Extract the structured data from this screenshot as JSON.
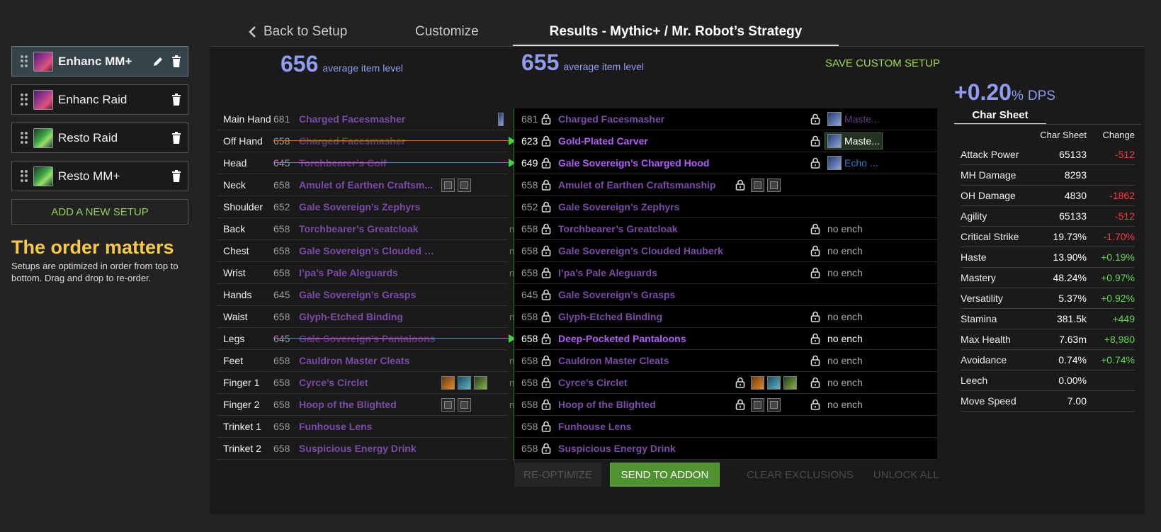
{
  "colors": {
    "accent": "#8f9cf0",
    "positive": "#5fd94a",
    "negative": "#ff3b3b",
    "epic": "#7b4ba8",
    "gold": "#f7c948",
    "green_action": "#4f9330"
  },
  "sidebar": {
    "setups": [
      {
        "name": "Enhanc MM+",
        "icon": "enhancement-icon",
        "active": true
      },
      {
        "name": "Enhanc Raid",
        "icon": "enhancement-icon",
        "active": false
      },
      {
        "name": "Resto Raid",
        "icon": "restoration-icon",
        "active": false
      },
      {
        "name": "Resto MM+",
        "icon": "restoration-icon",
        "active": false
      }
    ],
    "add_setup": "ADD A NEW SETUP",
    "order_title": "The order matters",
    "order_desc": "Setups are optimized in order from top to bottom. Drag and drop to re-order."
  },
  "tabs": {
    "back": "Back to Setup",
    "customize": "Customize",
    "results": "Results - Mythic+ / Mr. Robot’s Strategy"
  },
  "left": {
    "ilvl": "656",
    "ilvl_label": "average item level"
  },
  "right": {
    "ilvl": "655",
    "ilvl_label": "average item level",
    "save_custom": "SAVE CUSTOM SETUP"
  },
  "left_items": [
    {
      "slot": "Main Hand",
      "ilvl": "681",
      "name": "Charged Facesmasher",
      "changed": false,
      "trunc": ""
    },
    {
      "slot": "Off Hand",
      "ilvl": "658",
      "name": "Charged Facesmasher",
      "changed": true,
      "trunc": ""
    },
    {
      "slot": "Head",
      "ilvl": "645",
      "name": "Torchbearer’s Coif",
      "changed": true,
      "trunc": ""
    },
    {
      "slot": "Neck",
      "ilvl": "658",
      "name": "Amulet of Earthen Craftsm...",
      "changed": false,
      "trunc": ""
    },
    {
      "slot": "Shoulder",
      "ilvl": "652",
      "name": "Gale Sovereign’s Zephyrs",
      "changed": false,
      "trunc": ""
    },
    {
      "slot": "Back",
      "ilvl": "658",
      "name": "Torchbearer’s Greatcloak",
      "changed": false,
      "trunc": "n"
    },
    {
      "slot": "Chest",
      "ilvl": "658",
      "name": "Gale Sovereign’s Clouded H...",
      "changed": false,
      "trunc": "n"
    },
    {
      "slot": "Wrist",
      "ilvl": "658",
      "name": "I’pa’s Pale Aleguards",
      "changed": false,
      "trunc": "n"
    },
    {
      "slot": "Hands",
      "ilvl": "645",
      "name": "Gale Sovereign’s Grasps",
      "changed": false,
      "trunc": ""
    },
    {
      "slot": "Waist",
      "ilvl": "658",
      "name": "Glyph-Etched Binding",
      "changed": false,
      "trunc": "n"
    },
    {
      "slot": "Legs",
      "ilvl": "645",
      "name": "Gale Sovereign’s Pantaloons",
      "changed": true,
      "trunc": ""
    },
    {
      "slot": "Feet",
      "ilvl": "658",
      "name": "Cauldron Master Cleats",
      "changed": false,
      "trunc": "n"
    },
    {
      "slot": "Finger 1",
      "ilvl": "658",
      "name": "Cyrce’s Circlet",
      "changed": false,
      "trunc": "n"
    },
    {
      "slot": "Finger 2",
      "ilvl": "658",
      "name": "Hoop of the Blighted",
      "changed": false,
      "trunc": "n"
    },
    {
      "slot": "Trinket 1",
      "ilvl": "658",
      "name": "Funhouse Lens",
      "changed": false,
      "trunc": ""
    },
    {
      "slot": "Trinket 2",
      "ilvl": "658",
      "name": "Suspicious Energy Drink",
      "changed": false,
      "trunc": ""
    }
  ],
  "right_items": [
    {
      "ilvl": "681",
      "name": "Charged Facesmasher",
      "changed": false,
      "ench": "Maste...",
      "ench_style": "dim"
    },
    {
      "ilvl": "623",
      "name": "Gold-Plated Carver",
      "changed": true,
      "ench": "Maste...",
      "ench_style": "box"
    },
    {
      "ilvl": "649",
      "name": "Gale Sovereign’s Charged Hood",
      "changed": true,
      "ench": "Echo ...",
      "ench_style": "blue"
    },
    {
      "ilvl": "658",
      "name": "Amulet of Earthen Craftsmanship",
      "changed": false,
      "ench": "",
      "ench_style": ""
    },
    {
      "ilvl": "652",
      "name": "Gale Sovereign’s Zephyrs",
      "changed": false,
      "ench": "",
      "ench_style": ""
    },
    {
      "ilvl": "658",
      "name": "Torchbearer’s Greatcloak",
      "changed": false,
      "ench": "no ench",
      "ench_style": "plain"
    },
    {
      "ilvl": "658",
      "name": "Gale Sovereign’s Clouded Hauberk",
      "changed": false,
      "ench": "no ench",
      "ench_style": "plain"
    },
    {
      "ilvl": "658",
      "name": "I’pa’s Pale Aleguards",
      "changed": false,
      "ench": "no ench",
      "ench_style": "plain"
    },
    {
      "ilvl": "645",
      "name": "Gale Sovereign’s Grasps",
      "changed": false,
      "ench": "",
      "ench_style": ""
    },
    {
      "ilvl": "658",
      "name": "Glyph-Etched Binding",
      "changed": false,
      "ench": "no ench",
      "ench_style": "plain"
    },
    {
      "ilvl": "658",
      "name": "Deep-Pocketed Pantaloons",
      "changed": true,
      "ench": "no ench",
      "ench_style": "bright"
    },
    {
      "ilvl": "658",
      "name": "Cauldron Master Cleats",
      "changed": false,
      "ench": "no ench",
      "ench_style": "plain"
    },
    {
      "ilvl": "658",
      "name": "Cyrce’s Circlet",
      "changed": false,
      "ench": "no ench",
      "ench_style": "plain"
    },
    {
      "ilvl": "658",
      "name": "Hoop of the Blighted",
      "changed": false,
      "ench": "no ench",
      "ench_style": "plain"
    },
    {
      "ilvl": "658",
      "name": "Funhouse Lens",
      "changed": false,
      "ench": "",
      "ench_style": ""
    },
    {
      "ilvl": "658",
      "name": "Suspicious Energy Drink",
      "changed": false,
      "ench": "",
      "ench_style": ""
    }
  ],
  "buttons": {
    "reoptimize": "RE-OPTIMIZE",
    "send": "SEND TO ADDON",
    "clear": "CLEAR EXCLUSIONS",
    "unlock": "UNLOCK ALL"
  },
  "dps": {
    "value": "+0.20",
    "pct": "%",
    "unit": "DPS"
  },
  "char_sheet": {
    "tab": "Char Sheet",
    "col_value": "Char Sheet",
    "col_change": "Change",
    "stats": [
      {
        "name": "Attack Power",
        "value": "65133",
        "change": "-512",
        "dir": "neg"
      },
      {
        "name": "MH Damage",
        "value": "8293",
        "change": "",
        "dir": ""
      },
      {
        "name": "OH Damage",
        "value": "4830",
        "change": "-1862",
        "dir": "neg"
      },
      {
        "name": "Agility",
        "value": "65133",
        "change": "-512",
        "dir": "neg"
      },
      {
        "name": "Critical Strike",
        "value": "19.73%",
        "change": "-1.70%",
        "dir": "neg"
      },
      {
        "name": "Haste",
        "value": "13.90%",
        "change": "+0.19%",
        "dir": "pos"
      },
      {
        "name": "Mastery",
        "value": "48.24%",
        "change": "+0.97%",
        "dir": "pos"
      },
      {
        "name": "Versatility",
        "value": "5.37%",
        "change": "+0.92%",
        "dir": "pos"
      },
      {
        "name": "Stamina",
        "value": "381.5k",
        "change": "+449",
        "dir": "pos"
      },
      {
        "name": "Max Health",
        "value": "7.63m",
        "change": "+8,980",
        "dir": "pos"
      },
      {
        "name": "Avoidance",
        "value": "0.74%",
        "change": "+0.74%",
        "dir": "pos"
      },
      {
        "name": "Leech",
        "value": "0.00%",
        "change": "",
        "dir": ""
      },
      {
        "name": "Move Speed",
        "value": "7.00",
        "change": "",
        "dir": ""
      }
    ]
  }
}
